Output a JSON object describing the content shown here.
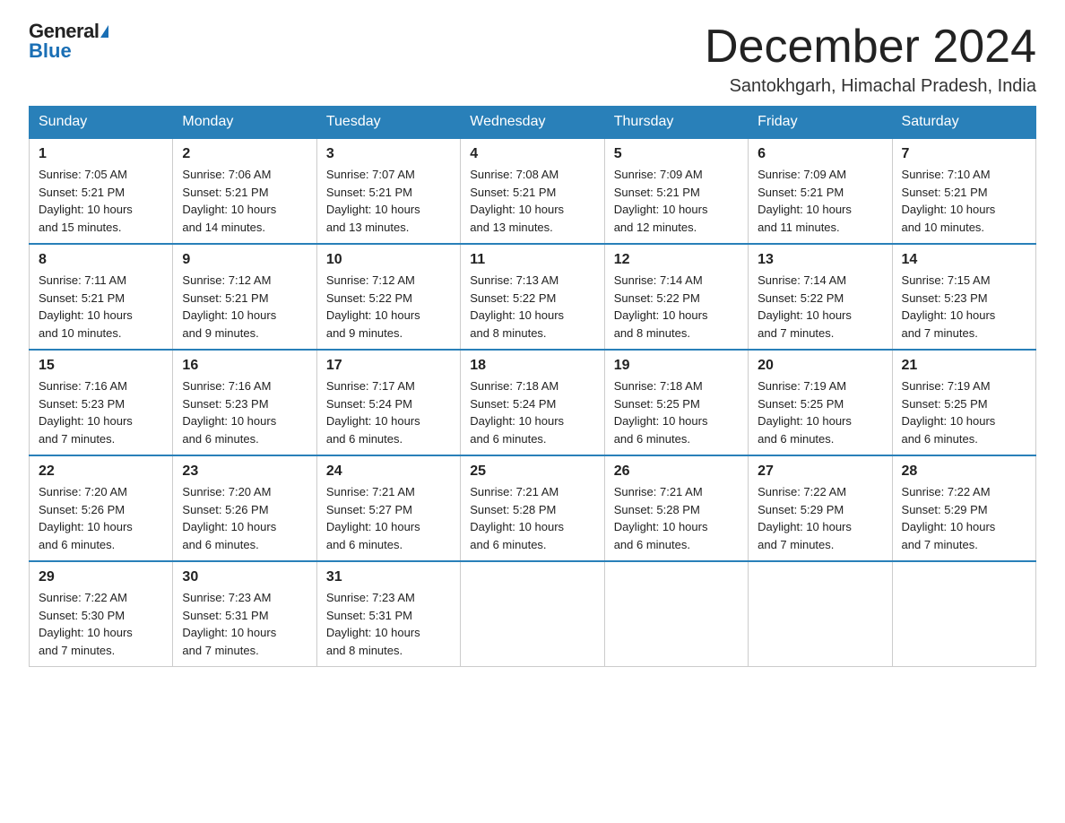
{
  "logo": {
    "text1": "General",
    "text2": "Blue"
  },
  "title": "December 2024",
  "subtitle": "Santokhgarh, Himachal Pradesh, India",
  "days": [
    "Sunday",
    "Monday",
    "Tuesday",
    "Wednesday",
    "Thursday",
    "Friday",
    "Saturday"
  ],
  "weeks": [
    [
      {
        "day": "1",
        "sunrise": "7:05 AM",
        "sunset": "5:21 PM",
        "daylight": "10 hours and 15 minutes."
      },
      {
        "day": "2",
        "sunrise": "7:06 AM",
        "sunset": "5:21 PM",
        "daylight": "10 hours and 14 minutes."
      },
      {
        "day": "3",
        "sunrise": "7:07 AM",
        "sunset": "5:21 PM",
        "daylight": "10 hours and 13 minutes."
      },
      {
        "day": "4",
        "sunrise": "7:08 AM",
        "sunset": "5:21 PM",
        "daylight": "10 hours and 13 minutes."
      },
      {
        "day": "5",
        "sunrise": "7:09 AM",
        "sunset": "5:21 PM",
        "daylight": "10 hours and 12 minutes."
      },
      {
        "day": "6",
        "sunrise": "7:09 AM",
        "sunset": "5:21 PM",
        "daylight": "10 hours and 11 minutes."
      },
      {
        "day": "7",
        "sunrise": "7:10 AM",
        "sunset": "5:21 PM",
        "daylight": "10 hours and 10 minutes."
      }
    ],
    [
      {
        "day": "8",
        "sunrise": "7:11 AM",
        "sunset": "5:21 PM",
        "daylight": "10 hours and 10 minutes."
      },
      {
        "day": "9",
        "sunrise": "7:12 AM",
        "sunset": "5:21 PM",
        "daylight": "10 hours and 9 minutes."
      },
      {
        "day": "10",
        "sunrise": "7:12 AM",
        "sunset": "5:22 PM",
        "daylight": "10 hours and 9 minutes."
      },
      {
        "day": "11",
        "sunrise": "7:13 AM",
        "sunset": "5:22 PM",
        "daylight": "10 hours and 8 minutes."
      },
      {
        "day": "12",
        "sunrise": "7:14 AM",
        "sunset": "5:22 PM",
        "daylight": "10 hours and 8 minutes."
      },
      {
        "day": "13",
        "sunrise": "7:14 AM",
        "sunset": "5:22 PM",
        "daylight": "10 hours and 7 minutes."
      },
      {
        "day": "14",
        "sunrise": "7:15 AM",
        "sunset": "5:23 PM",
        "daylight": "10 hours and 7 minutes."
      }
    ],
    [
      {
        "day": "15",
        "sunrise": "7:16 AM",
        "sunset": "5:23 PM",
        "daylight": "10 hours and 7 minutes."
      },
      {
        "day": "16",
        "sunrise": "7:16 AM",
        "sunset": "5:23 PM",
        "daylight": "10 hours and 6 minutes."
      },
      {
        "day": "17",
        "sunrise": "7:17 AM",
        "sunset": "5:24 PM",
        "daylight": "10 hours and 6 minutes."
      },
      {
        "day": "18",
        "sunrise": "7:18 AM",
        "sunset": "5:24 PM",
        "daylight": "10 hours and 6 minutes."
      },
      {
        "day": "19",
        "sunrise": "7:18 AM",
        "sunset": "5:25 PM",
        "daylight": "10 hours and 6 minutes."
      },
      {
        "day": "20",
        "sunrise": "7:19 AM",
        "sunset": "5:25 PM",
        "daylight": "10 hours and 6 minutes."
      },
      {
        "day": "21",
        "sunrise": "7:19 AM",
        "sunset": "5:25 PM",
        "daylight": "10 hours and 6 minutes."
      }
    ],
    [
      {
        "day": "22",
        "sunrise": "7:20 AM",
        "sunset": "5:26 PM",
        "daylight": "10 hours and 6 minutes."
      },
      {
        "day": "23",
        "sunrise": "7:20 AM",
        "sunset": "5:26 PM",
        "daylight": "10 hours and 6 minutes."
      },
      {
        "day": "24",
        "sunrise": "7:21 AM",
        "sunset": "5:27 PM",
        "daylight": "10 hours and 6 minutes."
      },
      {
        "day": "25",
        "sunrise": "7:21 AM",
        "sunset": "5:28 PM",
        "daylight": "10 hours and 6 minutes."
      },
      {
        "day": "26",
        "sunrise": "7:21 AM",
        "sunset": "5:28 PM",
        "daylight": "10 hours and 6 minutes."
      },
      {
        "day": "27",
        "sunrise": "7:22 AM",
        "sunset": "5:29 PM",
        "daylight": "10 hours and 7 minutes."
      },
      {
        "day": "28",
        "sunrise": "7:22 AM",
        "sunset": "5:29 PM",
        "daylight": "10 hours and 7 minutes."
      }
    ],
    [
      {
        "day": "29",
        "sunrise": "7:22 AM",
        "sunset": "5:30 PM",
        "daylight": "10 hours and 7 minutes."
      },
      {
        "day": "30",
        "sunrise": "7:23 AM",
        "sunset": "5:31 PM",
        "daylight": "10 hours and 7 minutes."
      },
      {
        "day": "31",
        "sunrise": "7:23 AM",
        "sunset": "5:31 PM",
        "daylight": "10 hours and 8 minutes."
      },
      null,
      null,
      null,
      null
    ]
  ],
  "labels": {
    "sunrise": "Sunrise:",
    "sunset": "Sunset:",
    "daylight": "Daylight:"
  }
}
